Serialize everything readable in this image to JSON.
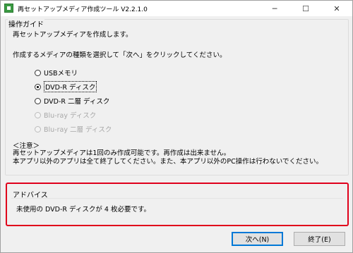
{
  "window": {
    "title": "再セットアップメディア作成ツール V2.2.1.0",
    "icon": "app-icon",
    "controls": {
      "minimize": "─",
      "maximize": "☐",
      "close": "✕"
    }
  },
  "guide": {
    "title": "操作ガイド",
    "intro": "再セットアップメディアを作成します。",
    "instruction": "作成するメディアの種類を選択して「次へ」をクリックしてください。",
    "options": [
      {
        "label": "USBメモリ",
        "checked": false,
        "enabled": true
      },
      {
        "label": "DVD-R ディスク",
        "checked": true,
        "enabled": true
      },
      {
        "label": "DVD-R 二層 ディスク",
        "checked": false,
        "enabled": true
      },
      {
        "label": "Blu-ray ディスク",
        "checked": false,
        "enabled": false
      },
      {
        "label": "Blu-ray 二層 ディスク",
        "checked": false,
        "enabled": false
      }
    ],
    "note_header": "＜注意＞",
    "note_line1": "再セットアップメディアは1回のみ作成可能です。再作成は出来ません。",
    "note_line2": "本アプリ以外のアプリは全て終了してください。また、本アプリ以外のPC操作は行わないでください。"
  },
  "advice": {
    "title": "アドバイス",
    "text": "未使用の DVD-R ディスクが 4 枚必要です。",
    "highlight_color": "#e0001b"
  },
  "buttons": {
    "next": "次へ(N)",
    "exit": "終了(E)"
  }
}
